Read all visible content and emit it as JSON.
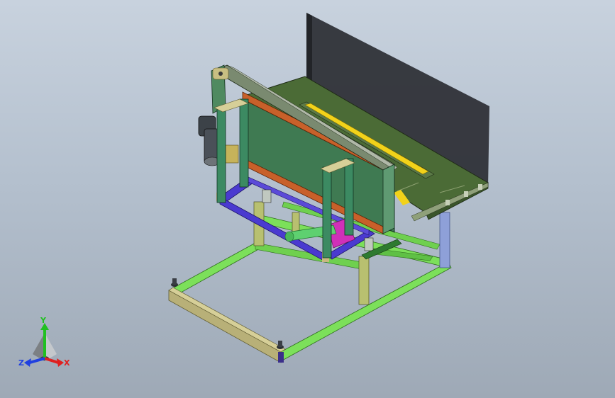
{
  "viewport": {
    "name": "3d-model-viewport"
  },
  "triad": {
    "x_label": "X",
    "y_label": "Y",
    "z_label": "Z",
    "x_color": "#e02020",
    "y_color": "#20c020",
    "z_color": "#2040e0"
  },
  "colors": {
    "background_top": "#c8d2de",
    "background_bottom": "#9ea9b6",
    "frame_green": "#7ce05a",
    "rail_khaki": "#b8b078",
    "table_top": "#4b6b36",
    "blade_slot": "#f2d21a",
    "guard_green": "#3f7a52",
    "frame_blue": "#4a3ad0",
    "beam_orange": "#c8602a",
    "motor_dark": "#3c4248",
    "shadow": "#2e3138"
  }
}
